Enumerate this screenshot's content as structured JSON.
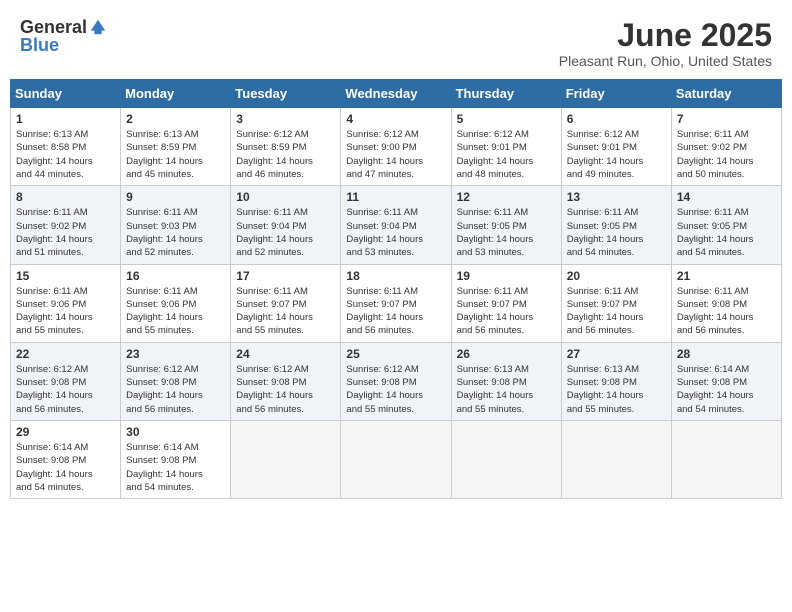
{
  "header": {
    "logo_general": "General",
    "logo_blue": "Blue",
    "month_title": "June 2025",
    "location": "Pleasant Run, Ohio, United States"
  },
  "weekdays": [
    "Sunday",
    "Monday",
    "Tuesday",
    "Wednesday",
    "Thursday",
    "Friday",
    "Saturday"
  ],
  "weeks": [
    [
      {
        "day": 1,
        "sunrise": "6:13 AM",
        "sunset": "8:58 PM",
        "daylight": "14 hours and 44 minutes."
      },
      {
        "day": 2,
        "sunrise": "6:13 AM",
        "sunset": "8:59 PM",
        "daylight": "14 hours and 45 minutes."
      },
      {
        "day": 3,
        "sunrise": "6:12 AM",
        "sunset": "8:59 PM",
        "daylight": "14 hours and 46 minutes."
      },
      {
        "day": 4,
        "sunrise": "6:12 AM",
        "sunset": "9:00 PM",
        "daylight": "14 hours and 47 minutes."
      },
      {
        "day": 5,
        "sunrise": "6:12 AM",
        "sunset": "9:01 PM",
        "daylight": "14 hours and 48 minutes."
      },
      {
        "day": 6,
        "sunrise": "6:12 AM",
        "sunset": "9:01 PM",
        "daylight": "14 hours and 49 minutes."
      },
      {
        "day": 7,
        "sunrise": "6:11 AM",
        "sunset": "9:02 PM",
        "daylight": "14 hours and 50 minutes."
      }
    ],
    [
      {
        "day": 8,
        "sunrise": "6:11 AM",
        "sunset": "9:02 PM",
        "daylight": "14 hours and 51 minutes."
      },
      {
        "day": 9,
        "sunrise": "6:11 AM",
        "sunset": "9:03 PM",
        "daylight": "14 hours and 52 minutes."
      },
      {
        "day": 10,
        "sunrise": "6:11 AM",
        "sunset": "9:04 PM",
        "daylight": "14 hours and 52 minutes."
      },
      {
        "day": 11,
        "sunrise": "6:11 AM",
        "sunset": "9:04 PM",
        "daylight": "14 hours and 53 minutes."
      },
      {
        "day": 12,
        "sunrise": "6:11 AM",
        "sunset": "9:05 PM",
        "daylight": "14 hours and 53 minutes."
      },
      {
        "day": 13,
        "sunrise": "6:11 AM",
        "sunset": "9:05 PM",
        "daylight": "14 hours and 54 minutes."
      },
      {
        "day": 14,
        "sunrise": "6:11 AM",
        "sunset": "9:05 PM",
        "daylight": "14 hours and 54 minutes."
      }
    ],
    [
      {
        "day": 15,
        "sunrise": "6:11 AM",
        "sunset": "9:06 PM",
        "daylight": "14 hours and 55 minutes."
      },
      {
        "day": 16,
        "sunrise": "6:11 AM",
        "sunset": "9:06 PM",
        "daylight": "14 hours and 55 minutes."
      },
      {
        "day": 17,
        "sunrise": "6:11 AM",
        "sunset": "9:07 PM",
        "daylight": "14 hours and 55 minutes."
      },
      {
        "day": 18,
        "sunrise": "6:11 AM",
        "sunset": "9:07 PM",
        "daylight": "14 hours and 56 minutes."
      },
      {
        "day": 19,
        "sunrise": "6:11 AM",
        "sunset": "9:07 PM",
        "daylight": "14 hours and 56 minutes."
      },
      {
        "day": 20,
        "sunrise": "6:11 AM",
        "sunset": "9:07 PM",
        "daylight": "14 hours and 56 minutes."
      },
      {
        "day": 21,
        "sunrise": "6:11 AM",
        "sunset": "9:08 PM",
        "daylight": "14 hours and 56 minutes."
      }
    ],
    [
      {
        "day": 22,
        "sunrise": "6:12 AM",
        "sunset": "9:08 PM",
        "daylight": "14 hours and 56 minutes."
      },
      {
        "day": 23,
        "sunrise": "6:12 AM",
        "sunset": "9:08 PM",
        "daylight": "14 hours and 56 minutes."
      },
      {
        "day": 24,
        "sunrise": "6:12 AM",
        "sunset": "9:08 PM",
        "daylight": "14 hours and 56 minutes."
      },
      {
        "day": 25,
        "sunrise": "6:12 AM",
        "sunset": "9:08 PM",
        "daylight": "14 hours and 55 minutes."
      },
      {
        "day": 26,
        "sunrise": "6:13 AM",
        "sunset": "9:08 PM",
        "daylight": "14 hours and 55 minutes."
      },
      {
        "day": 27,
        "sunrise": "6:13 AM",
        "sunset": "9:08 PM",
        "daylight": "14 hours and 55 minutes."
      },
      {
        "day": 28,
        "sunrise": "6:14 AM",
        "sunset": "9:08 PM",
        "daylight": "14 hours and 54 minutes."
      }
    ],
    [
      {
        "day": 29,
        "sunrise": "6:14 AM",
        "sunset": "9:08 PM",
        "daylight": "14 hours and 54 minutes."
      },
      {
        "day": 30,
        "sunrise": "6:14 AM",
        "sunset": "9:08 PM",
        "daylight": "14 hours and 54 minutes."
      },
      null,
      null,
      null,
      null,
      null
    ]
  ]
}
